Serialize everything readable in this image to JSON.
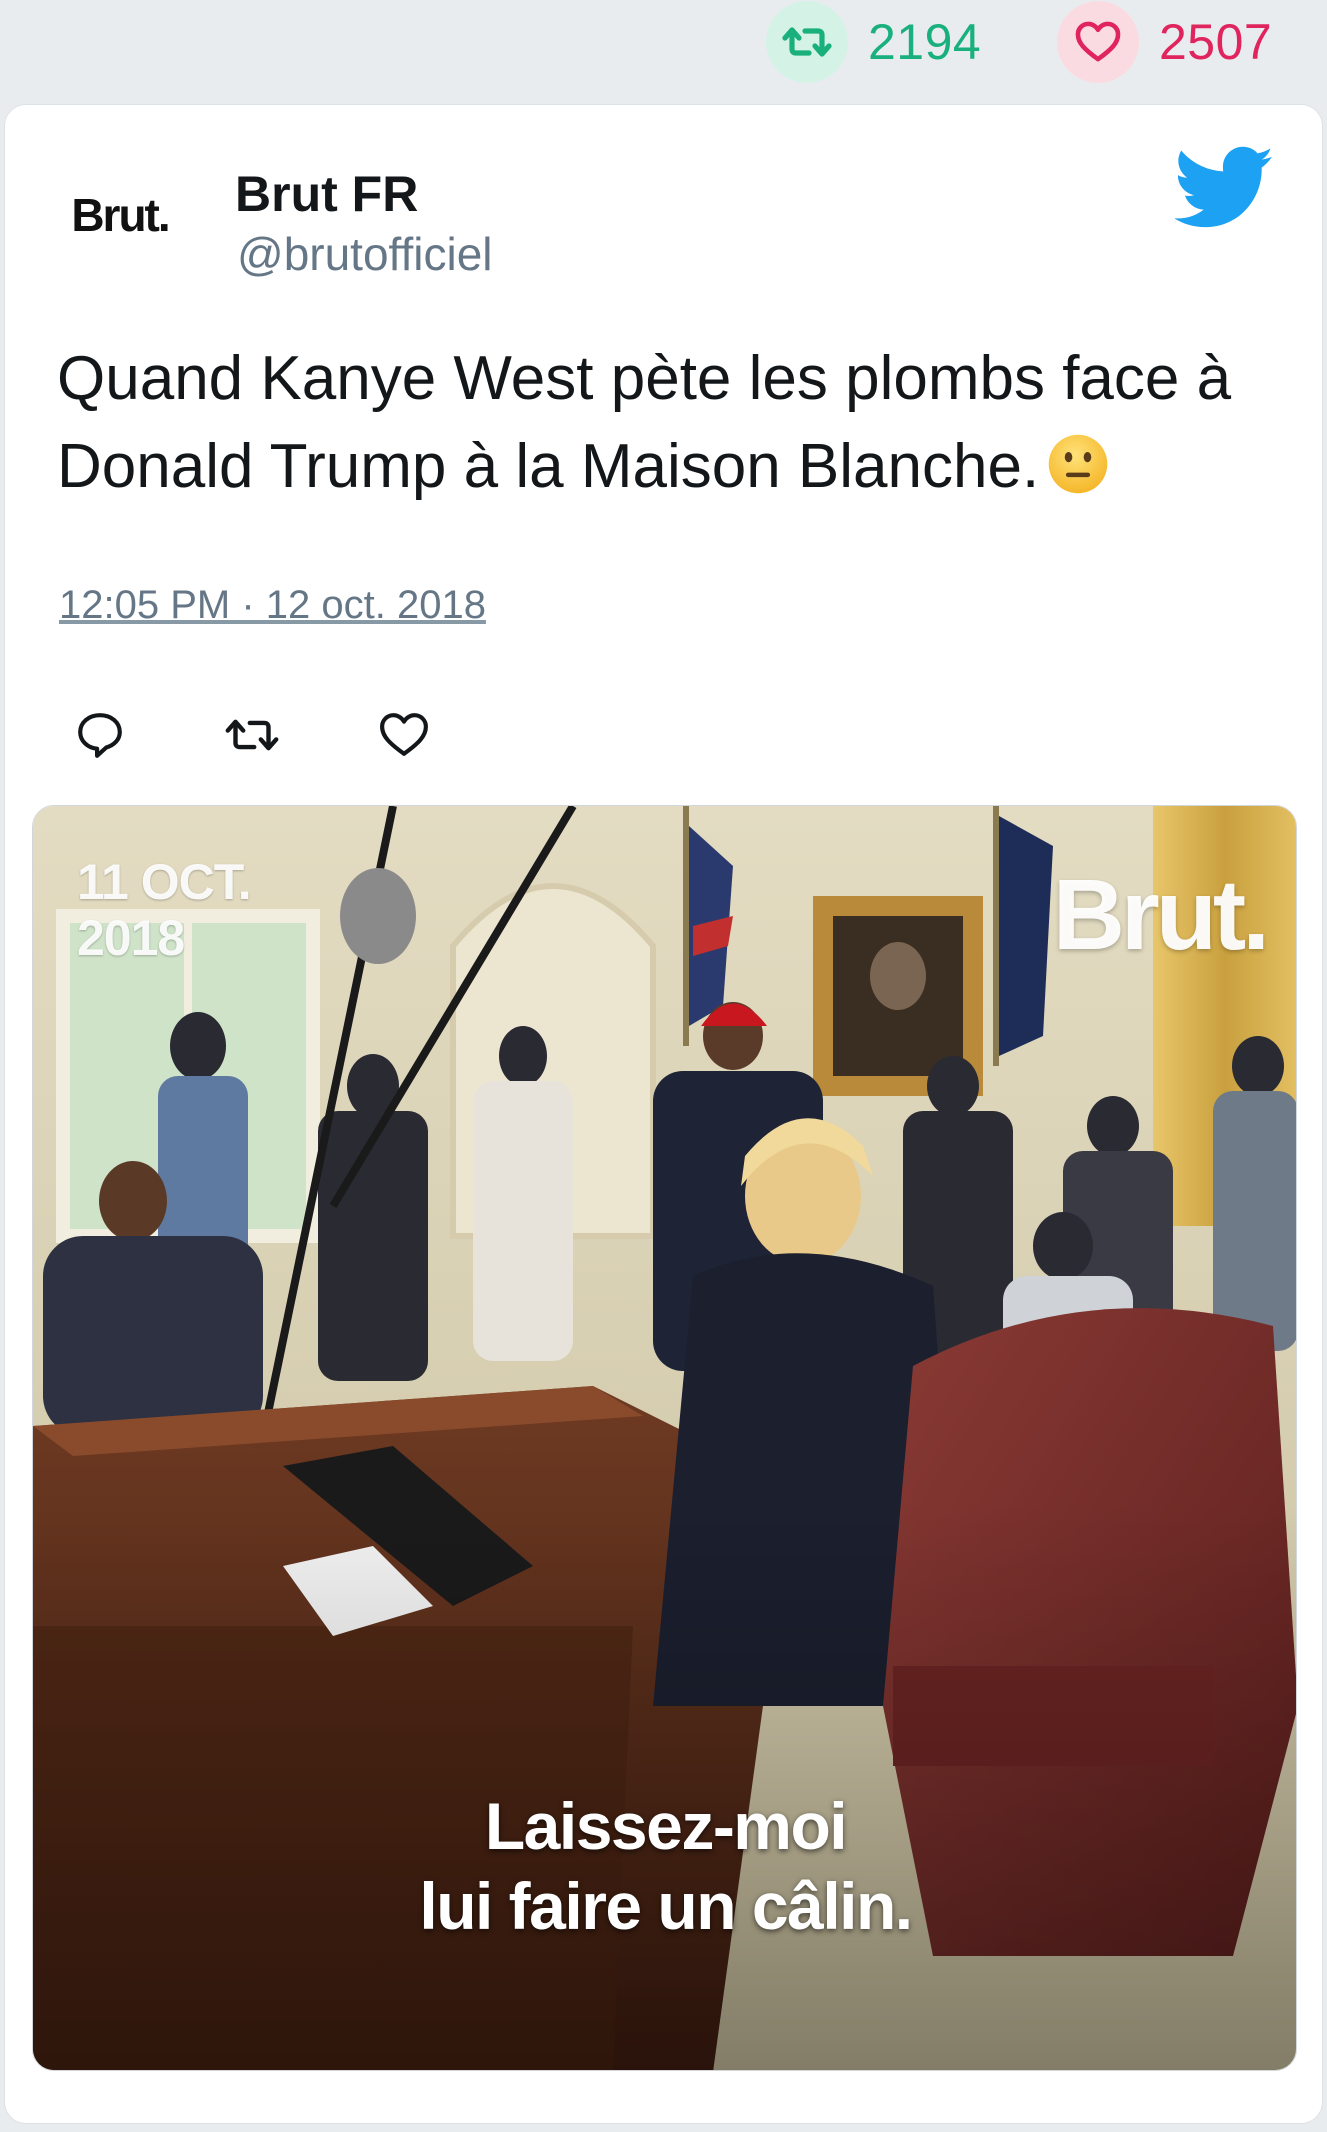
{
  "stats": {
    "retweet_count": "2194",
    "like_count": "2507",
    "retweet_color": "#19b07d",
    "like_color": "#e0245e"
  },
  "tweet": {
    "author_name": "Brut FR",
    "author_handle": "@brutofficiel",
    "avatar_text": "Brut.",
    "text": "Quand Kanye West pète les plombs face à Donald Trump à la Maison Blanche.",
    "emoji": "neutral-face",
    "timestamp": "12:05 PM · 12 oct. 2018",
    "icons": {
      "platform": "twitter-bird-icon",
      "reply": "reply-icon",
      "retweet": "retweet-icon",
      "like": "heart-icon"
    },
    "brand_color": "#1da1f2"
  },
  "media": {
    "date_overlay": "11 OCT.\n2018",
    "brand_overlay": "Brut.",
    "subtitle_line1": "Laissez-moi",
    "subtitle_line2": "lui faire un câlin."
  }
}
